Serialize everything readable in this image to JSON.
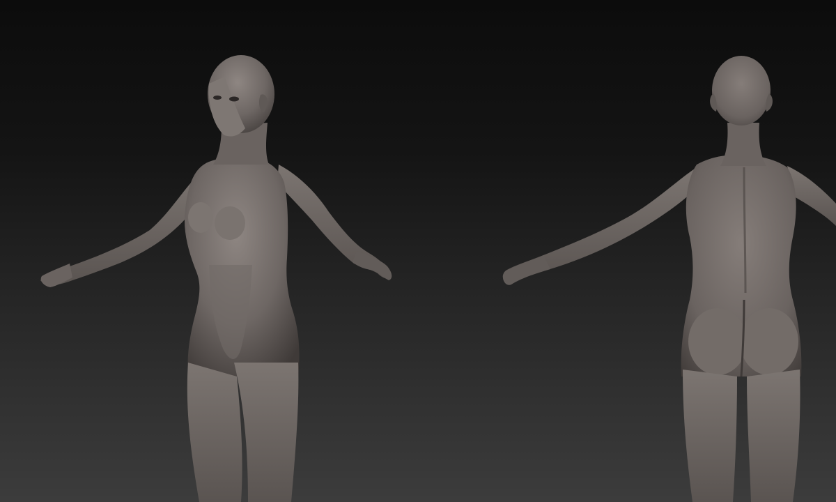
{
  "viewport": {
    "background_top": "#0c0c0c",
    "background_bottom": "#3c3c3c",
    "material_color": "#6e6764",
    "material_shadow": "#3f3a38",
    "material_highlight": "#9a928e"
  },
  "models": [
    {
      "view": "front-three-quarter"
    },
    {
      "view": "back"
    }
  ]
}
